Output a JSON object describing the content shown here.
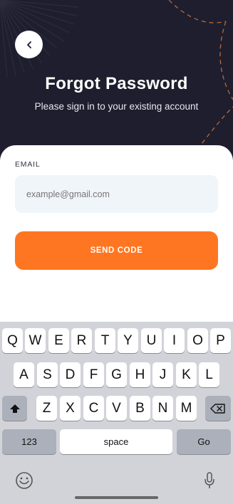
{
  "header": {
    "title": "Forgot Password",
    "subtitle": "Please sign in to your existing account"
  },
  "form": {
    "email_label": "EMAIL",
    "email_placeholder": "example@gmail.com",
    "send_button": "SEND CODE"
  },
  "keyboard": {
    "row1": [
      "Q",
      "W",
      "E",
      "R",
      "T",
      "Y",
      "U",
      "I",
      "O",
      "P"
    ],
    "row2": [
      "A",
      "S",
      "D",
      "F",
      "G",
      "H",
      "J",
      "K",
      "L"
    ],
    "row3": [
      "Z",
      "X",
      "C",
      "V",
      "B",
      "N",
      "M"
    ],
    "numbers_key": "123",
    "space_key": "space",
    "go_key": "Go"
  },
  "colors": {
    "header_bg": "#1e1e2e",
    "accent": "#ff7622",
    "input_bg": "#f0f5fa"
  }
}
